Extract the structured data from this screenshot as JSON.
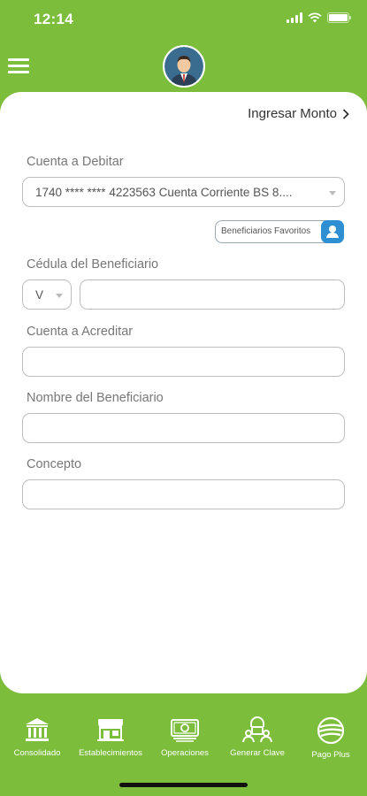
{
  "status_bar": {
    "time": "12:14"
  },
  "header": {
    "menu_icon": "hamburger-icon",
    "avatar_icon": "user-avatar"
  },
  "main": {
    "ingresar_monto": "Ingresar Monto",
    "cuenta_debitar": {
      "label": "Cuenta a Debitar",
      "value": "1740 **** **** 4223563 Cuenta Corriente BS 8...."
    },
    "beneficiarios_favoritos": "Beneficiarios Favoritos",
    "cedula": {
      "label": "Cédula del Beneficiario",
      "prefix": "V",
      "value": ""
    },
    "cuenta_acreditar": {
      "label": "Cuenta a Acreditar",
      "value": ""
    },
    "nombre": {
      "label": "Nombre del Beneficiario",
      "value": ""
    },
    "concepto": {
      "label": "Concepto",
      "value": ""
    }
  },
  "tabbar": {
    "items": [
      {
        "label": "Consolidado",
        "icon": "bank-icon"
      },
      {
        "label": "Establecimientos",
        "icon": "store-icon"
      },
      {
        "label": "Operaciones",
        "icon": "money-icon"
      },
      {
        "label": "Generar Clave",
        "icon": "lock-users-icon"
      },
      {
        "label": "Pago Plus",
        "icon": "pago-plus-icon"
      }
    ]
  },
  "colors": {
    "brand_green": "#7cbd3c",
    "accent_blue": "#2f8fd3"
  }
}
